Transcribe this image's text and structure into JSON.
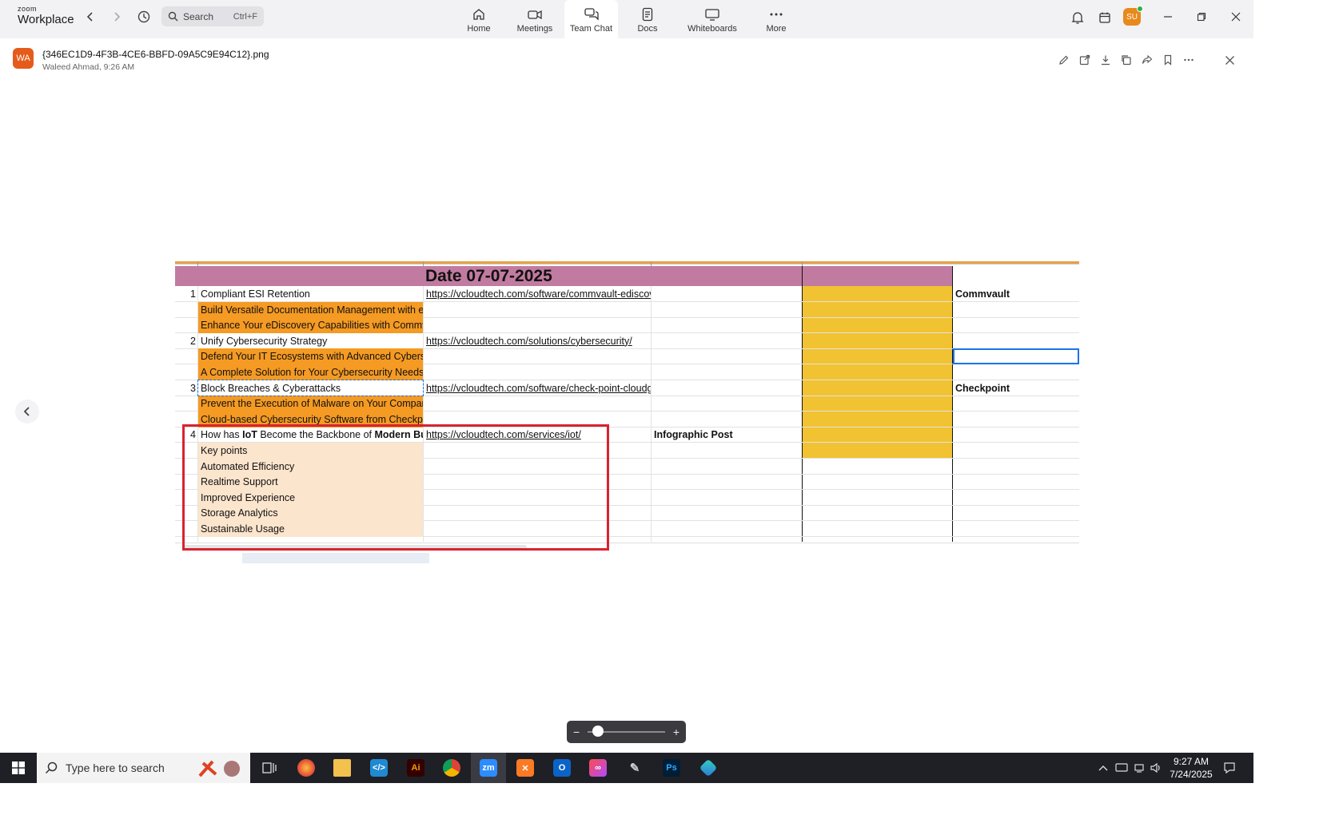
{
  "app": {
    "logo_small": "zoom",
    "logo_big": "Workplace",
    "search_placeholder": "Search",
    "search_shortcut": "Ctrl+F",
    "tabs": [
      {
        "label": "Home",
        "icon": "home-icon"
      },
      {
        "label": "Meetings",
        "icon": "video-icon"
      },
      {
        "label": "Team Chat",
        "icon": "chat-icon",
        "active": true
      },
      {
        "label": "Docs",
        "icon": "docs-icon"
      },
      {
        "label": "Whiteboards",
        "icon": "whiteboard-icon"
      },
      {
        "label": "More",
        "icon": "more-icon"
      }
    ],
    "user_initials": "SU",
    "accent": "#e8891c"
  },
  "file": {
    "avatar_initials": "WA",
    "name": "{346EC1D9-4F3B-4CE6-BBFD-09A5C9E94C12}.png",
    "meta": "Waleed Ahmad, 9:26 AM"
  },
  "sheet": {
    "date_title": "Date 07-07-2025",
    "rows": [
      {
        "num": "1",
        "title": "Compliant ESI Retention",
        "url": "https://vcloudtech.com/software/commvault-ediscovery/",
        "brand": "Commvault"
      },
      {
        "title": "Build Versatile Documentation Management with eDiscovery",
        "style": "orange"
      },
      {
        "title": "Enhance Your eDiscovery Capabilities with Commvault",
        "style": "orange"
      },
      {
        "num": "2",
        "title": "Unify Cybersecurity Strategy",
        "url": "https://vcloudtech.com/solutions/cybersecurity/"
      },
      {
        "title": "Defend Your IT Ecosystems with Advanced Cybersecurity",
        "style": "orange"
      },
      {
        "title": "A Complete Solution for Your Cybersecurity Needs",
        "style": "orange"
      },
      {
        "num": "3",
        "title": "Block Breaches & Cyberattacks",
        "url": "https://vcloudtech.com/software/check-point-cloudguard/",
        "brand": "Checkpoint"
      },
      {
        "title": "Prevent the Execution of Malware on Your Company Network",
        "style": "orange"
      },
      {
        "title": "Cloud-based Cybersecurity Software from Checkpoint",
        "style": "orange"
      },
      {
        "num": "4",
        "title_parts": [
          "How has ",
          "IoT",
          " Become the Backbone of ",
          "Modern Business"
        ],
        "url": "https://vcloudtech.com/services/iot/",
        "type": "Infographic Post"
      },
      {
        "title": "Key points",
        "style": "peach"
      },
      {
        "title": "Automated Efficiency",
        "style": "peach"
      },
      {
        "title": "Realtime Support",
        "style": "peach"
      },
      {
        "title": "Improved Experience",
        "style": "peach"
      },
      {
        "title": "Storage Analytics",
        "style": "peach"
      },
      {
        "title": "Sustainable Usage",
        "style": "peach"
      }
    ],
    "colors": {
      "header": "#c27ba0",
      "orange": "#f59a23",
      "peach": "#fce5cd",
      "yellow": "#f1c232",
      "highlight": "#d9232e"
    }
  },
  "zoom": {
    "level": 0.08,
    "minus": "−",
    "plus": "+"
  },
  "taskbar": {
    "search_placeholder": "Type here to search",
    "time": "9:27 AM",
    "date": "7/24/2025",
    "apps": [
      "firefox-icon",
      "file-explorer-icon",
      "vscode-icon",
      "illustrator-icon",
      "chrome-icon",
      "zoom-icon",
      "xampp-icon",
      "outlook-icon",
      "creative-cloud-icon",
      "pen-tool-icon",
      "photoshop-icon",
      "app-icon"
    ]
  }
}
